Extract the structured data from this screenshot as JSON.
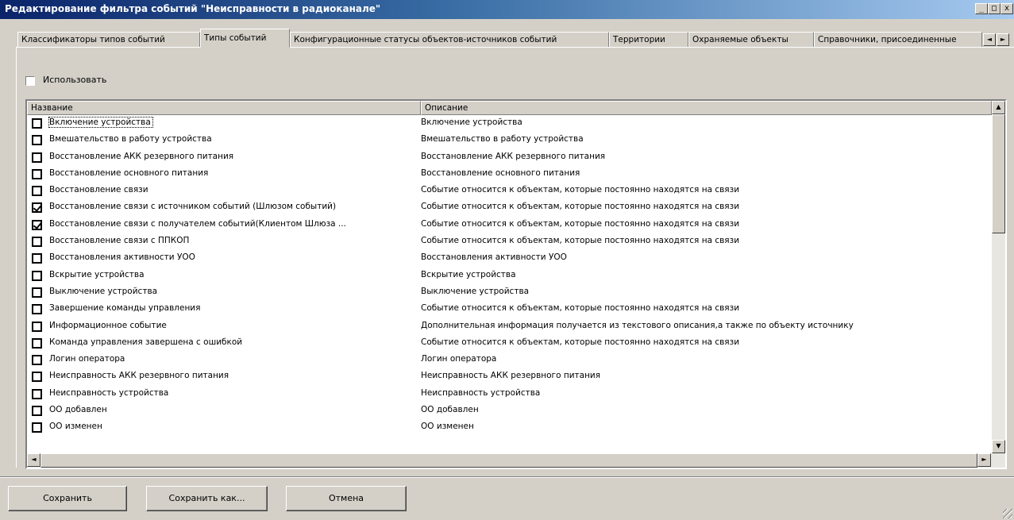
{
  "window": {
    "title": "Редактирование фильтра событий \"Неисправности в радиоканале\"",
    "minimize_glyph": "_",
    "maximize_glyph": "□",
    "close_glyph": "x"
  },
  "tabs": [
    {
      "label": "Классификаторы типов событий"
    },
    {
      "label": "Типы событий"
    },
    {
      "label": "Конфигурационные статусы объектов-источников событий"
    },
    {
      "label": "Территории"
    },
    {
      "label": "Охраняемые объекты"
    },
    {
      "label": "Справочники, присоединенные"
    }
  ],
  "tab_scroll": {
    "left": "◄",
    "right": "►"
  },
  "use_checkbox": {
    "label": "Использовать",
    "checked": false
  },
  "list": {
    "columns": [
      "Название",
      "Описание"
    ],
    "rows": [
      {
        "name": "Включение устройства",
        "desc": "Включение устройства",
        "checked": false
      },
      {
        "name": "Вмешательство в работу устройства",
        "desc": "Вмешательство в работу устройства",
        "checked": false
      },
      {
        "name": "Восстановление АКК резервного питания",
        "desc": "Восстановление АКК резервного питания",
        "checked": false
      },
      {
        "name": "Восстановление основного питания",
        "desc": "Восстановление основного питания",
        "checked": false
      },
      {
        "name": "Восстановление связи",
        "desc": "Событие относится к объектам, которые постоянно находятся на связи",
        "checked": false
      },
      {
        "name": "Восстановление связи с источником событий (Шлюзом событий)",
        "desc": "Событие относится к объектам, которые постоянно находятся на связи",
        "checked": true
      },
      {
        "name": "Восстановление связи с получателем событий(Клиентом Шлюза ...",
        "desc": "Событие относится к объектам, которые постоянно находятся на связи",
        "checked": true
      },
      {
        "name": "Восстановление связи с ППКОП",
        "desc": "Событие относится к объектам, которые постоянно находятся на связи",
        "checked": false
      },
      {
        "name": "Восстановления активности УОО",
        "desc": "Восстановления активности УОО",
        "checked": false
      },
      {
        "name": "Вскрытие устройства",
        "desc": "Вскрытие устройства",
        "checked": false
      },
      {
        "name": "Выключение устройства",
        "desc": "Выключение устройства",
        "checked": false
      },
      {
        "name": "Завершение команды управления",
        "desc": "Событие относится к объектам, которые постоянно находятся на связи",
        "checked": false
      },
      {
        "name": "Информационное событие",
        "desc": "Дополнительная информация получается из текстового описания,а также по объекту источнику",
        "checked": false
      },
      {
        "name": "Команда управления завершена с ошибкой",
        "desc": "Событие относится к объектам, которые постоянно находятся на связи",
        "checked": false
      },
      {
        "name": "Логин оператора",
        "desc": "Логин оператора",
        "checked": false
      },
      {
        "name": "Неисправность АКК резервного питания",
        "desc": "Неисправность АКК резервного питания",
        "checked": false
      },
      {
        "name": "Неисправность устройства",
        "desc": "Неисправность устройства",
        "checked": false
      },
      {
        "name": "ОО добавлен",
        "desc": "ОО добавлен",
        "checked": false
      },
      {
        "name": "ОО изменен",
        "desc": "ОО изменен",
        "checked": false
      }
    ]
  },
  "scroll_glyphs": {
    "up": "▲",
    "down": "▼",
    "left": "◄",
    "right": "►"
  },
  "buttons": {
    "save": "Сохранить",
    "save_as": "Сохранить как...",
    "cancel": "Отмена"
  }
}
